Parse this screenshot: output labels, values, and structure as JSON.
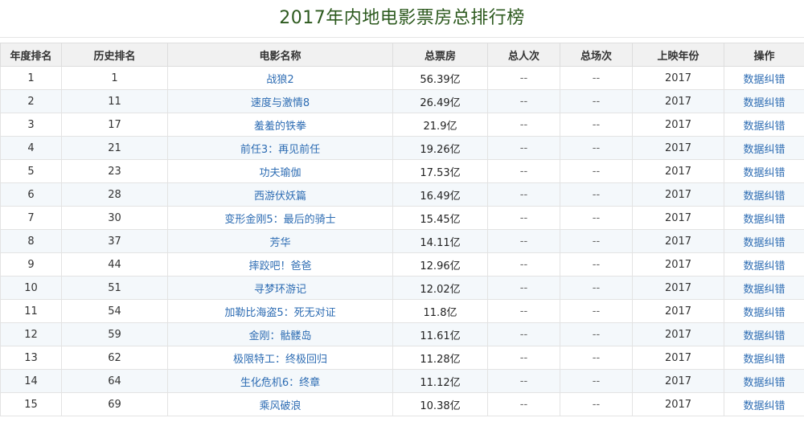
{
  "page_title": "2017年内地电影票房总排行榜",
  "columns": [
    "年度排名",
    "历史排名",
    "电影名称",
    "总票房",
    "总人次",
    "总场次",
    "上映年份",
    "操作"
  ],
  "rows": [
    {
      "year_rank": "1",
      "hist_rank": "1",
      "title": "战狼2",
      "gross": "56.39亿",
      "attendance": "--",
      "screenings": "--",
      "year": "2017",
      "action": "数据纠错"
    },
    {
      "year_rank": "2",
      "hist_rank": "11",
      "title": "速度与激情8",
      "gross": "26.49亿",
      "attendance": "--",
      "screenings": "--",
      "year": "2017",
      "action": "数据纠错"
    },
    {
      "year_rank": "3",
      "hist_rank": "17",
      "title": "羞羞的铁拳",
      "gross": "21.9亿",
      "attendance": "--",
      "screenings": "--",
      "year": "2017",
      "action": "数据纠错"
    },
    {
      "year_rank": "4",
      "hist_rank": "21",
      "title": "前任3：再见前任",
      "gross": "19.26亿",
      "attendance": "--",
      "screenings": "--",
      "year": "2017",
      "action": "数据纠错"
    },
    {
      "year_rank": "5",
      "hist_rank": "23",
      "title": "功夫瑜伽",
      "gross": "17.53亿",
      "attendance": "--",
      "screenings": "--",
      "year": "2017",
      "action": "数据纠错"
    },
    {
      "year_rank": "6",
      "hist_rank": "28",
      "title": "西游伏妖篇",
      "gross": "16.49亿",
      "attendance": "--",
      "screenings": "--",
      "year": "2017",
      "action": "数据纠错"
    },
    {
      "year_rank": "7",
      "hist_rank": "30",
      "title": "变形金刚5：最后的骑士",
      "gross": "15.45亿",
      "attendance": "--",
      "screenings": "--",
      "year": "2017",
      "action": "数据纠错"
    },
    {
      "year_rank": "8",
      "hist_rank": "37",
      "title": "芳华",
      "gross": "14.11亿",
      "attendance": "--",
      "screenings": "--",
      "year": "2017",
      "action": "数据纠错"
    },
    {
      "year_rank": "9",
      "hist_rank": "44",
      "title": "摔跤吧！爸爸",
      "gross": "12.96亿",
      "attendance": "--",
      "screenings": "--",
      "year": "2017",
      "action": "数据纠错"
    },
    {
      "year_rank": "10",
      "hist_rank": "51",
      "title": "寻梦环游记",
      "gross": "12.02亿",
      "attendance": "--",
      "screenings": "--",
      "year": "2017",
      "action": "数据纠错"
    },
    {
      "year_rank": "11",
      "hist_rank": "54",
      "title": "加勒比海盗5：死无对证",
      "gross": "11.8亿",
      "attendance": "--",
      "screenings": "--",
      "year": "2017",
      "action": "数据纠错"
    },
    {
      "year_rank": "12",
      "hist_rank": "59",
      "title": "金刚：骷髅岛",
      "gross": "11.61亿",
      "attendance": "--",
      "screenings": "--",
      "year": "2017",
      "action": "数据纠错"
    },
    {
      "year_rank": "13",
      "hist_rank": "62",
      "title": "极限特工：终极回归",
      "gross": "11.28亿",
      "attendance": "--",
      "screenings": "--",
      "year": "2017",
      "action": "数据纠错"
    },
    {
      "year_rank": "14",
      "hist_rank": "64",
      "title": "生化危机6：终章",
      "gross": "11.12亿",
      "attendance": "--",
      "screenings": "--",
      "year": "2017",
      "action": "数据纠错"
    },
    {
      "year_rank": "15",
      "hist_rank": "69",
      "title": "乘风破浪",
      "gross": "10.38亿",
      "attendance": "--",
      "screenings": "--",
      "year": "2017",
      "action": "数据纠错"
    }
  ],
  "colors": {
    "title": "#2d5a1f",
    "link": "#2d6cb3",
    "alt_row": "#f4f8fb",
    "header_bg": "#f1f1f1"
  }
}
